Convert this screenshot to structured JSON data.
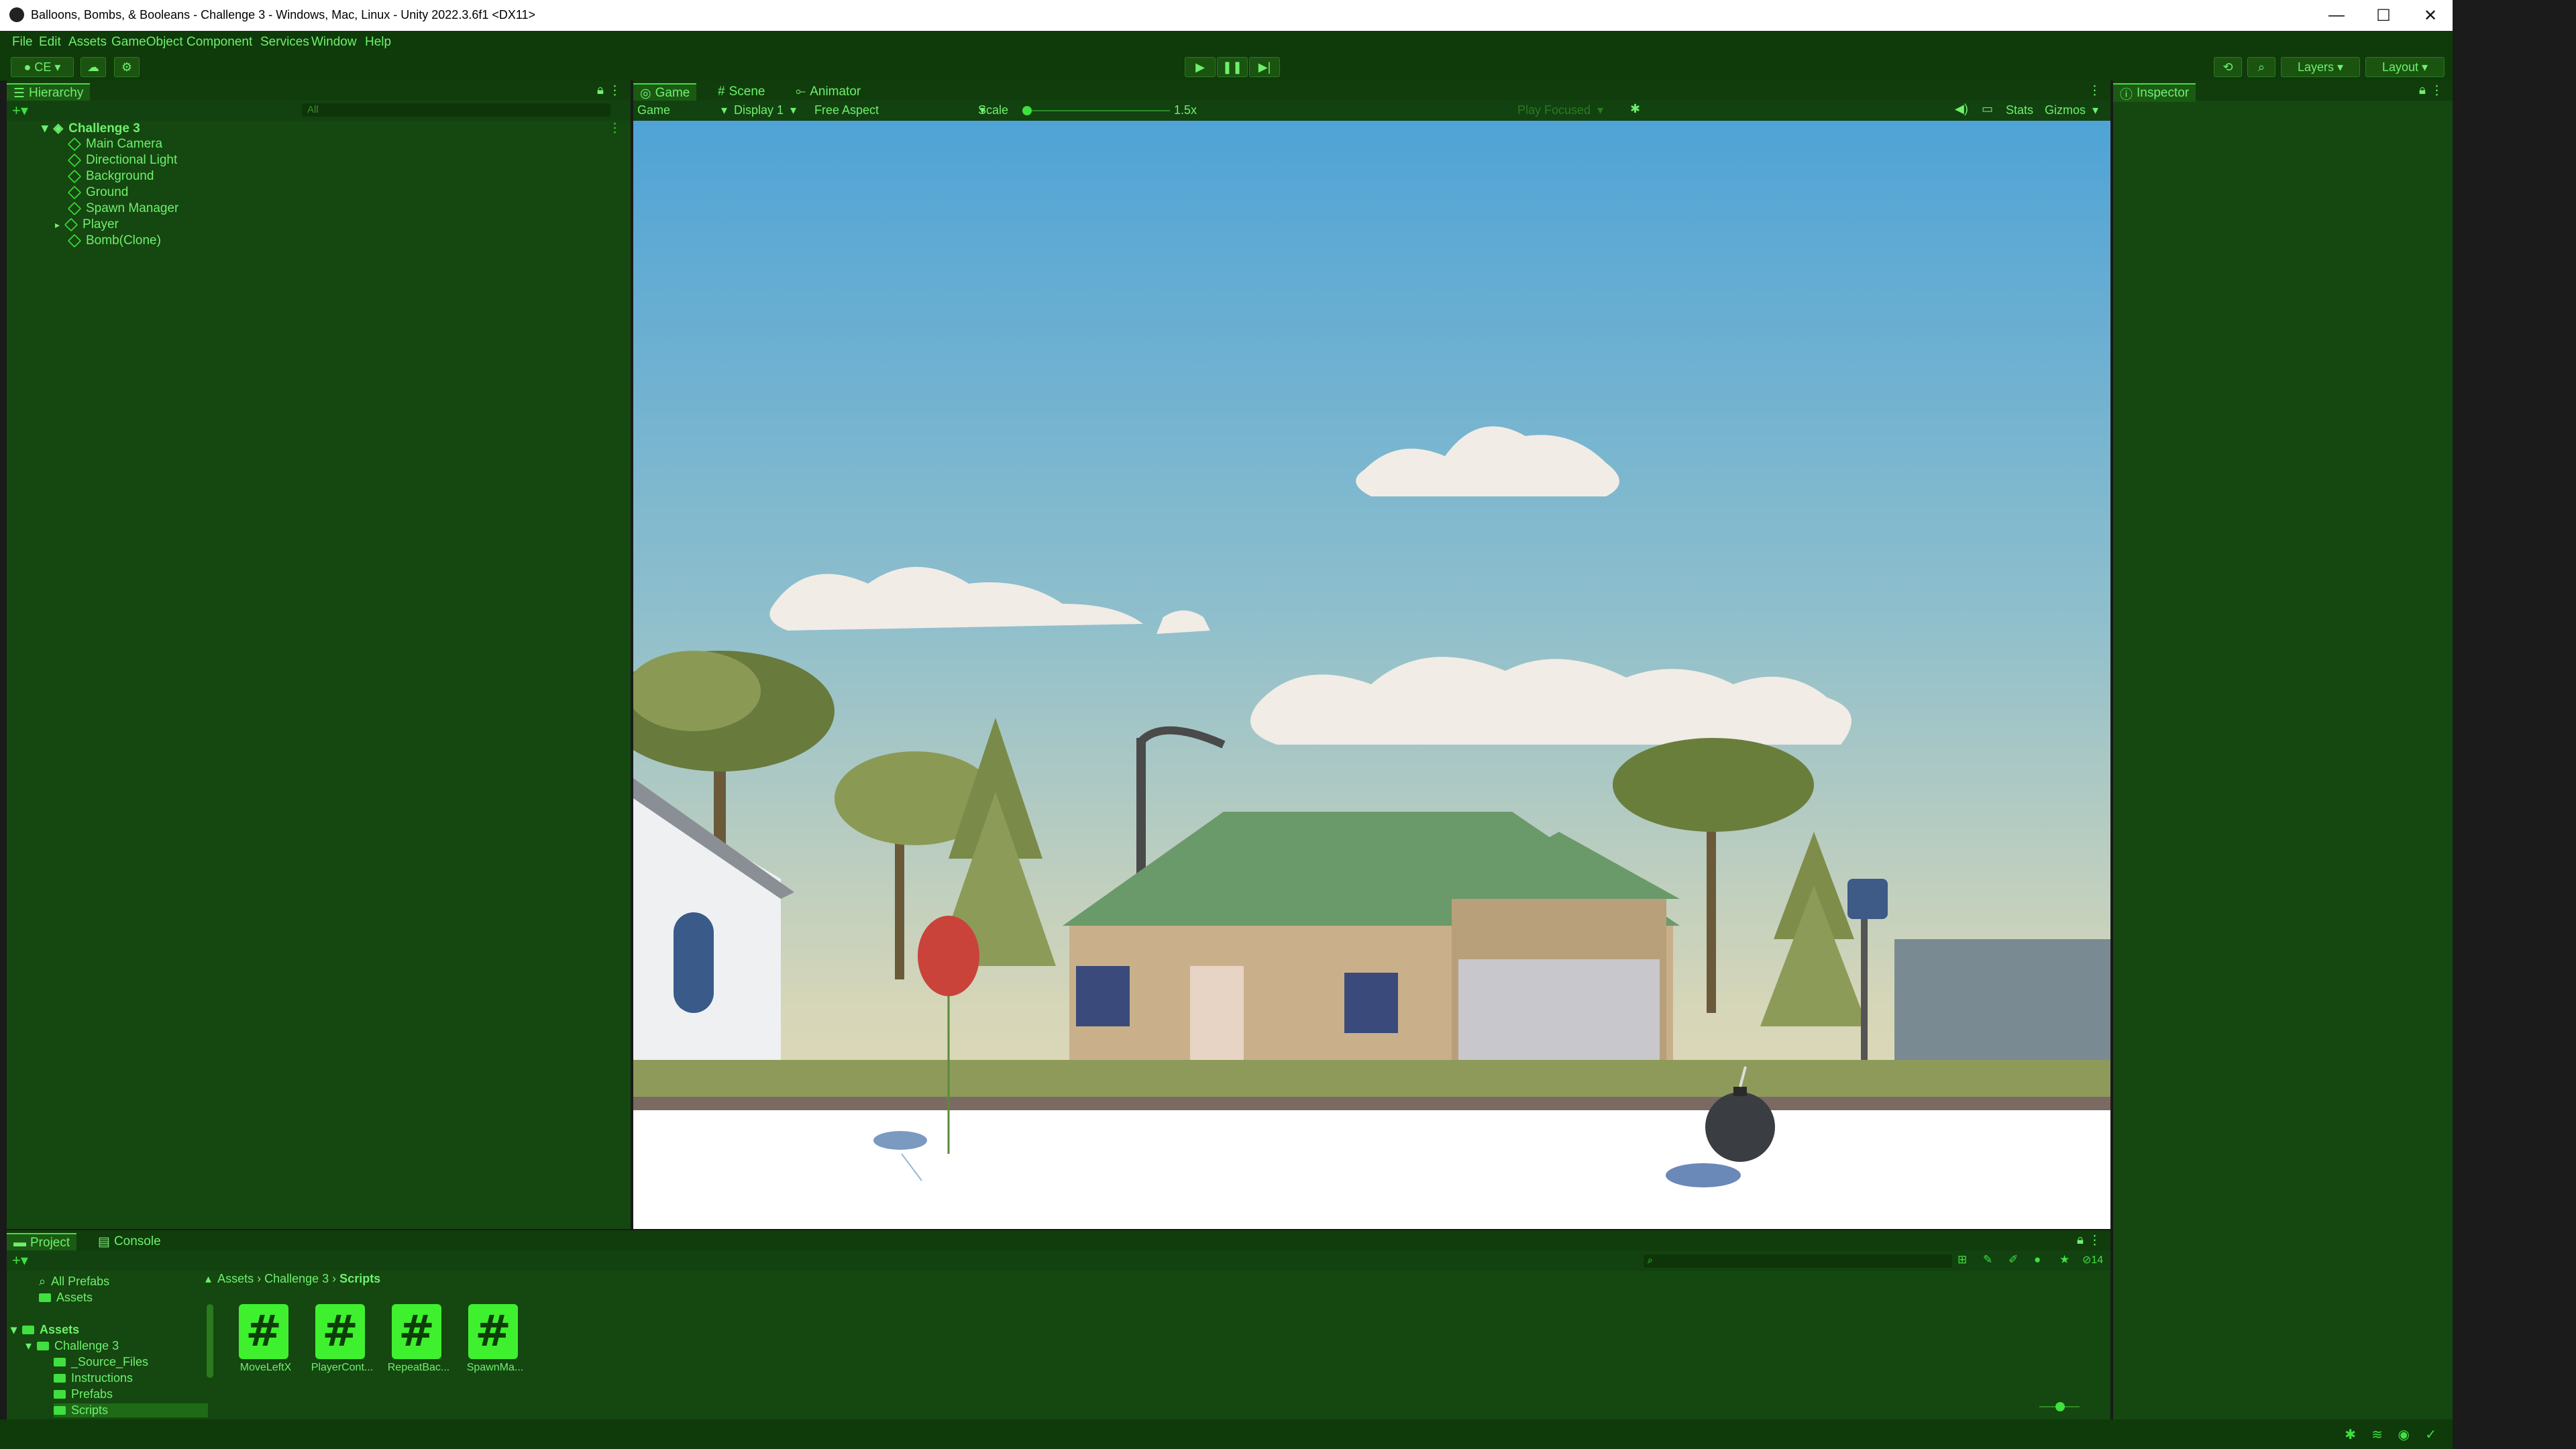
{
  "window": {
    "title": "Balloons, Bombs, & Booleans - Challenge 3 - Windows, Mac, Linux - Unity 2022.3.6f1 <DX11>",
    "minimize": "—",
    "maximize": "☐",
    "close": "✕"
  },
  "menu": [
    "File",
    "Edit",
    "Assets",
    "GameObject",
    "Component",
    "Services",
    "Window",
    "Help"
  ],
  "toolbar": {
    "account": "CE",
    "layers": "Layers",
    "layout": "Layout"
  },
  "hierarchy": {
    "tab": "Hierarchy",
    "search_placeholder": "All",
    "scene": "Challenge 3",
    "items": [
      "Main Camera",
      "Directional Light",
      "Background",
      "Ground",
      "Spawn Manager",
      "Player",
      "Bomb(Clone)"
    ]
  },
  "game_tabs": [
    "Game",
    "Scene",
    "Animator"
  ],
  "game_toolbar": {
    "mode": "Game",
    "display": "Display 1",
    "aspect": "Free Aspect",
    "scale_label": "Scale",
    "scale_value": "1.5x",
    "play_focused": "Play Focused",
    "stats": "Stats",
    "gizmos": "Gizmos"
  },
  "inspector": {
    "tab": "Inspector"
  },
  "project": {
    "tabs": [
      "Project",
      "Console"
    ],
    "favorites": [
      "All Prefabs",
      "Assets"
    ],
    "tree": [
      "Assets",
      "Challenge 3",
      "_Source_Files",
      "Instructions",
      "Prefabs",
      "Scripts"
    ],
    "breadcrumb": [
      "Assets",
      "Challenge 3",
      "Scripts"
    ],
    "scripts": [
      "MoveLeftX",
      "PlayerCont...",
      "RepeatBac...",
      "SpawnMa..."
    ],
    "hidden_count": "14"
  },
  "colors": {
    "ui_green_bg": "#154710",
    "ui_green_text": "#6ef06e",
    "sky_top": "#4fa3d6",
    "sky_bottom": "#e8dcc0",
    "balloon": "#c9433a",
    "bomb": "#3a3d42"
  }
}
